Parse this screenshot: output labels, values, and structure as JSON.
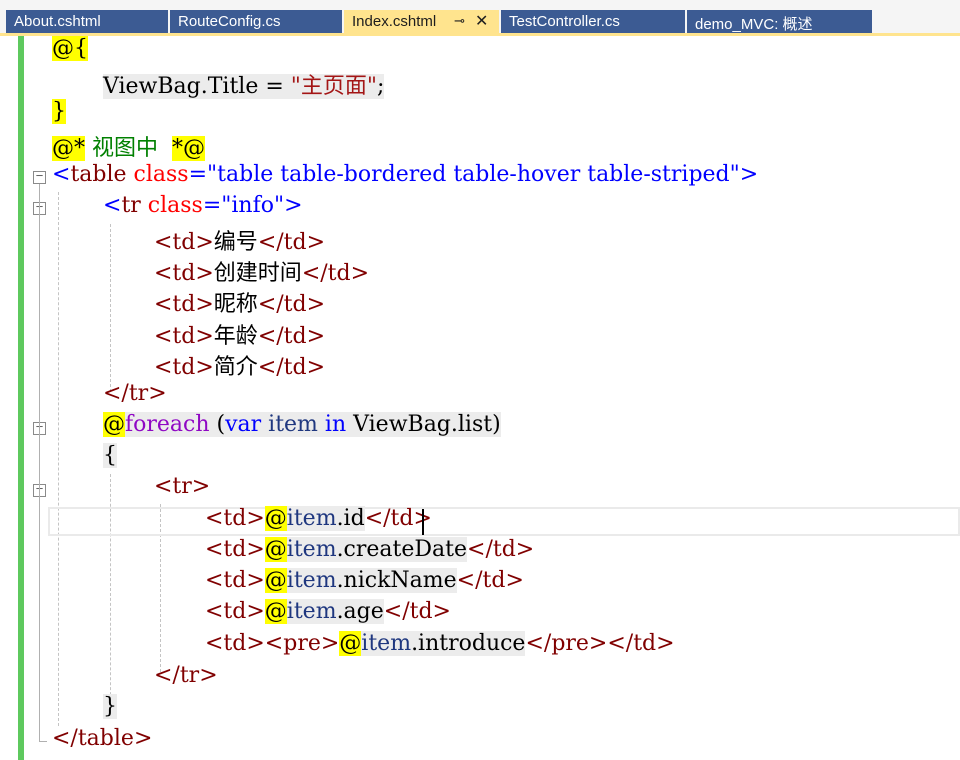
{
  "tabs": [
    {
      "label": "About.cshtml",
      "active": false
    },
    {
      "label": "RouteConfig.cs",
      "active": false
    },
    {
      "label": "Index.cshtml",
      "active": true
    },
    {
      "label": "TestController.cs",
      "active": false
    },
    {
      "label": "demo_MVC: 概述",
      "active": false
    }
  ],
  "tab_icons": [
    "pin-icon",
    "close-icon"
  ],
  "code": {
    "l0_at": "@{",
    "l1_prop": "ViewBag.Title",
    "l1_eq": " = ",
    "l1_str": "\"主页面\"",
    "l1_semi": ";",
    "l2_brace": "}",
    "l3_open": "@*",
    "l3_comment": " 视图中  ",
    "l3_close": "*@",
    "l4_lt": "<",
    "l4_tag": "table",
    "l4_attr": " class",
    "l4_eq": "=",
    "l4_val": "\"table table-bordered table-hover table-striped\"",
    "l4_gt": ">",
    "l5_lt": "<",
    "l5_tag": "tr",
    "l5_attr": " class",
    "l5_eq": "=",
    "l5_val": "\"info\"",
    "l5_gt": ">",
    "td_open": "<td>",
    "td_close": "</td>",
    "header_cells": [
      "编号",
      "创建时间",
      "昵称",
      "年龄",
      "简介"
    ],
    "tr_close": "</tr>",
    "tr_open": "<tr>",
    "foreach_at": "@",
    "foreach_kw": "foreach",
    "foreach_paren": " (",
    "foreach_var": "var",
    "foreach_item": " item ",
    "foreach_in": "in",
    "foreach_list": " ViewBag.list)",
    "open_brace": "{",
    "close_brace": "}",
    "item_at": "@",
    "item_obj": "item",
    "item_props": [
      ".id",
      ".createDate",
      ".nickName",
      ".age",
      ".introduce"
    ],
    "pre_open": "<pre>",
    "pre_close": "</pre>",
    "table_close": "</table>"
  }
}
